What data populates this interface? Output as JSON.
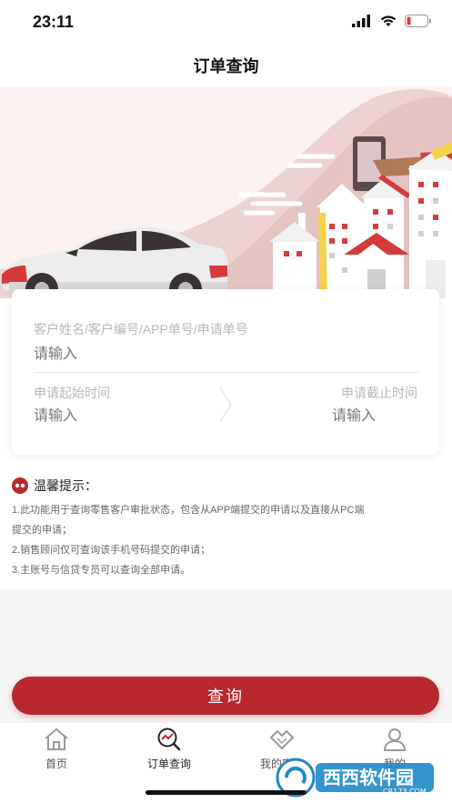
{
  "status_bar": {
    "time": "23:11"
  },
  "nav": {
    "title": "订单查询"
  },
  "form": {
    "customer_label": "客户姓名/客户编号/APP单号/申请单号",
    "customer_placeholder": "请输入",
    "start_label": "申请起始时间",
    "start_placeholder": "请输入",
    "end_label": "申请截止时间",
    "end_placeholder": "请输入"
  },
  "tips": {
    "title": "温馨提示：",
    "lines": [
      "1.此功能用于查询零售客户审批状态，包含从APP端提交的申请以及直接从PC端",
      "提交的申请；",
      "2.销售顾问仅可查询该手机号码提交的申请；",
      "3.主账号与信贷专员可以查询全部申请。"
    ]
  },
  "query_button": {
    "label": "查询"
  },
  "tab_bar": {
    "tabs": [
      {
        "label": "首页",
        "icon": "home-icon"
      },
      {
        "label": "订单查询",
        "icon": "order-search-icon"
      },
      {
        "label": "我的客户",
        "icon": "handshake-icon"
      },
      {
        "label": "我的",
        "icon": "user-icon"
      }
    ]
  },
  "watermark": {
    "text": "西西软件园",
    "sub": "CR173.COM"
  },
  "colors": {
    "accent": "#b9282c",
    "hero_bg": "#fbf1f1"
  }
}
